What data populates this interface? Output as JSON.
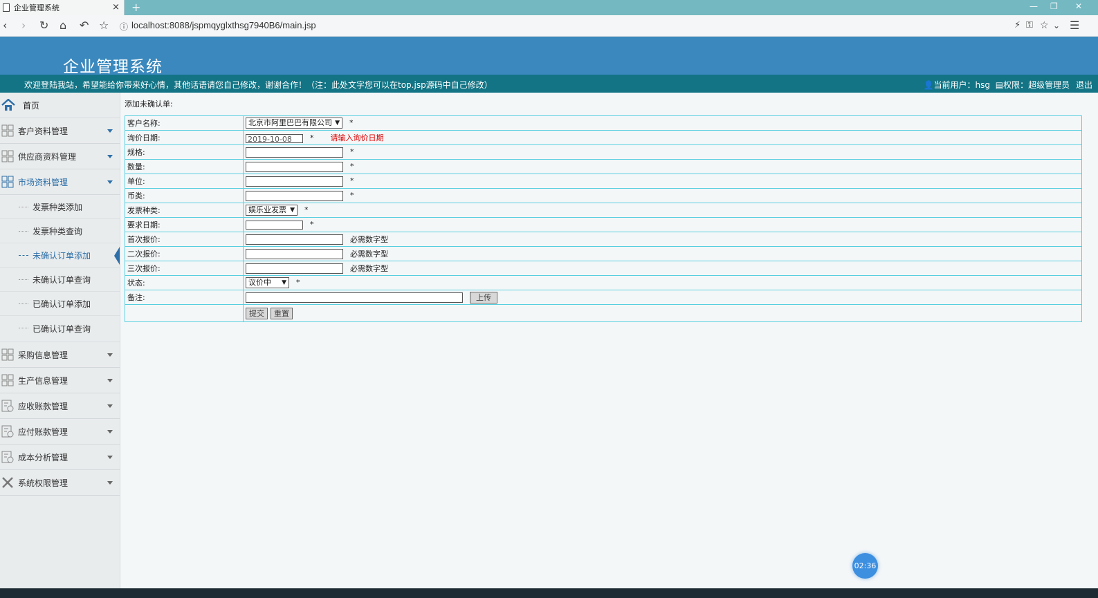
{
  "browser": {
    "tab_title": "企业管理系统",
    "tab_close": "×",
    "new_tab": "+",
    "url": "localhost:8088/jspmqyglxthsg7940B6/main.jsp"
  },
  "header": {
    "title": "企业管理系统",
    "welcome": "欢迎登陆我站，希望能给你带来好心情，其他话语请您自己修改，谢谢合作！（注：此处文字您可以在top.jsp源码中自己修改）",
    "current_user": "当前用户：hsg",
    "role": "权限：超级管理员",
    "logout": "退出"
  },
  "sidebar": {
    "home": "首页",
    "groups_top": [
      {
        "label": "客户资料管理",
        "icon": "grid-icon"
      },
      {
        "label": "供应商资料管理",
        "icon": "grid-icon"
      },
      {
        "label": "市场资料管理",
        "icon": "grid-icon"
      }
    ],
    "sub_items": [
      "发票种类添加",
      "发票种类查询",
      "未确认订单添加",
      "未确认订单查询",
      "已确认订单添加",
      "已确认订单查询"
    ],
    "groups_bottom": [
      {
        "label": "采购信息管理",
        "icon": "grid-icon"
      },
      {
        "label": "生产信息管理",
        "icon": "grid-icon"
      },
      {
        "label": "应收账款管理",
        "icon": "ledger-icon"
      },
      {
        "label": "应付账款管理",
        "icon": "ledger-icon"
      },
      {
        "label": "成本分析管理",
        "icon": "ledger-icon"
      },
      {
        "label": "系统权限管理",
        "icon": "tools-icon"
      }
    ]
  },
  "form": {
    "caption": "添加未确认单:",
    "customer_label": "客户名称:",
    "customer_value": "北京市阿里巴巴有限公司",
    "inquiry_date_label": "询价日期:",
    "inquiry_date_value": "2019-10-08",
    "inquiry_date_error": "请输入询价日期",
    "spec_label": "规格:",
    "quantity_label": "数量:",
    "unit_label": "单位:",
    "currency_label": "币类:",
    "invoice_type_label": "发票种类:",
    "invoice_type_value": "娱乐业发票",
    "required_date_label": "要求日期:",
    "first_quote_label": "首次报价:",
    "second_quote_label": "二次报价:",
    "third_quote_label": "三次报价:",
    "numeric_hint": "必需数字型",
    "status_label": "状态:",
    "status_value": "议价中",
    "remark_label": "备注:",
    "upload_button": "上传",
    "submit_button": "提交",
    "reset_button": "重置",
    "required_mark": "*"
  },
  "timer": "02:36"
}
